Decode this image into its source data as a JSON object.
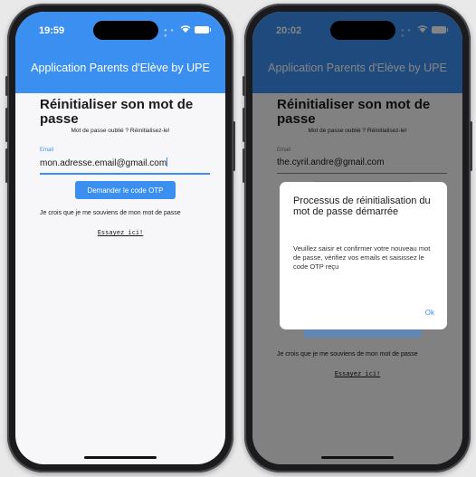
{
  "left_screen": {
    "status": {
      "time": "19:59"
    },
    "appbar": {
      "title": "Application Parents d'Elève by UPE"
    },
    "page": {
      "title": "Réinitialiser son mot de passe",
      "subtitle": "Mot de passe oublié ? Réinitialisez-le!",
      "email_label": "Email",
      "email_value": "mon.adresse.email@gmail.com",
      "otp_button": "Demander le code OTP",
      "remember_text": "Je crois que je me souviens de mon mot de passe",
      "try_link": "Essayez ici!"
    }
  },
  "right_screen": {
    "status": {
      "time": "20:02"
    },
    "appbar": {
      "title": "Application Parents d'Elève by UPE"
    },
    "page": {
      "title": "Réinitialiser son mot de passe",
      "subtitle": "Mot de passe oublié ? Réinitialisez-le!",
      "email_label": "Email",
      "email_value": "the.cyril.andre@gmail.com",
      "remember_text": "Je crois que je me souviens de mon mot de passe",
      "try_link": "Essayez ici!"
    },
    "dialog": {
      "title": "Processus de réinitialisation du mot de passe démarrée",
      "body": "Veuillez saisir et confirmer votre nouveau mot de passe, vérifiez vos emails et saisissez le code OTP reçu",
      "ok_button": "Ok"
    }
  },
  "colors": {
    "accent": "#3a8ff1",
    "background": "#f7f7f9",
    "dialog_overlay": "rgba(0,0,0,0.48)"
  },
  "icons": [
    "wifi-icon",
    "battery-icon"
  ]
}
